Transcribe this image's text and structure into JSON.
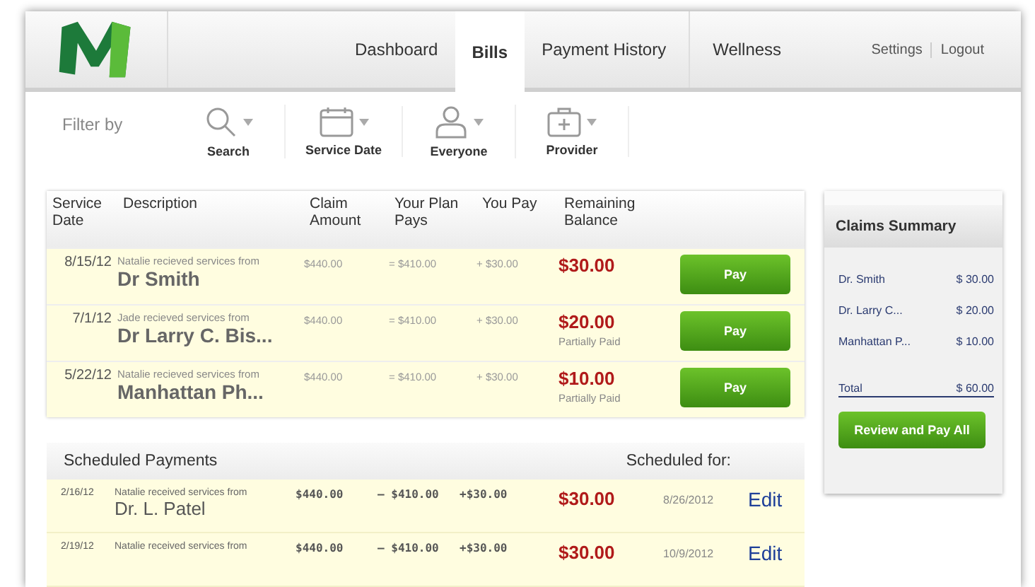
{
  "nav": {
    "items": [
      {
        "label": "Dashboard",
        "selected": false
      },
      {
        "label": "Bills",
        "selected": true
      },
      {
        "label": "Payment History",
        "selected": false
      },
      {
        "label": "Wellness",
        "selected": false
      }
    ],
    "links": [
      "Settings",
      "Logout"
    ]
  },
  "filters": {
    "label": "Filter by",
    "items": [
      {
        "kind": "search",
        "label": "Search"
      },
      {
        "kind": "calendar",
        "label": "Service Date"
      },
      {
        "kind": "person",
        "label": "Everyone"
      },
      {
        "kind": "kit",
        "label": "Provider"
      }
    ]
  },
  "bills": {
    "columns": [
      "Service Date",
      "Description",
      "Claim Amount",
      "Your Plan Pays",
      "You Pay",
      "Remaining Balance"
    ],
    "rows": [
      {
        "date": "8/15/12",
        "who": "Natalie recieved services from",
        "provider": "Dr Smith",
        "claim": "$440.00",
        "plan": "= $410.00",
        "pay": "+ $30.00",
        "balance": "$30.00",
        "button": "Pay"
      },
      {
        "date": "7/1/12",
        "who": "Jade recieved services from",
        "provider": "Dr Larry C. Bis...",
        "claim": "$440.00",
        "plan": "= $410.00",
        "pay": "+ $30.00",
        "balance": "$20.00",
        "status": "Partially Paid",
        "button": "Pay"
      },
      {
        "date": "5/22/12",
        "who": "Natalie recieved services from",
        "provider": "Manhattan Ph...",
        "claim": "$440.00",
        "plan": "= $410.00",
        "pay": "+ $30.00",
        "balance": "$10.00",
        "status": "Partially Paid",
        "button": "Pay"
      }
    ]
  },
  "summary": {
    "title": "Claims Summary",
    "rows": [
      {
        "name": "Dr. Smith",
        "amount": "$ 30.00"
      },
      {
        "name": "Dr. Larry C...",
        "amount": "$ 20.00"
      },
      {
        "name": "Manhattan P...",
        "amount": "$ 10.00"
      }
    ],
    "total": {
      "label": "Total",
      "amount": "$ 60.00"
    },
    "button": "Review and Pay All"
  },
  "scheduled": {
    "title": "Scheduled Payments",
    "date_heading": "Scheduled for:",
    "rows": [
      {
        "date": "2/16/12",
        "who": "Natalie received services from",
        "provider": "Dr. L. Patel",
        "claim": "$440.00",
        "plan": "– $410.00",
        "pay": "+$30.00",
        "amount": "$30.00",
        "scheduled": "8/26/2012",
        "action": "Edit"
      },
      {
        "date": "2/19/12",
        "who": "Natalie received services from",
        "claim": "$440.00",
        "plan": "– $410.00",
        "pay": "+$30.00",
        "amount": "$30.00",
        "scheduled": "10/9/2012",
        "action": "Edit"
      }
    ]
  }
}
